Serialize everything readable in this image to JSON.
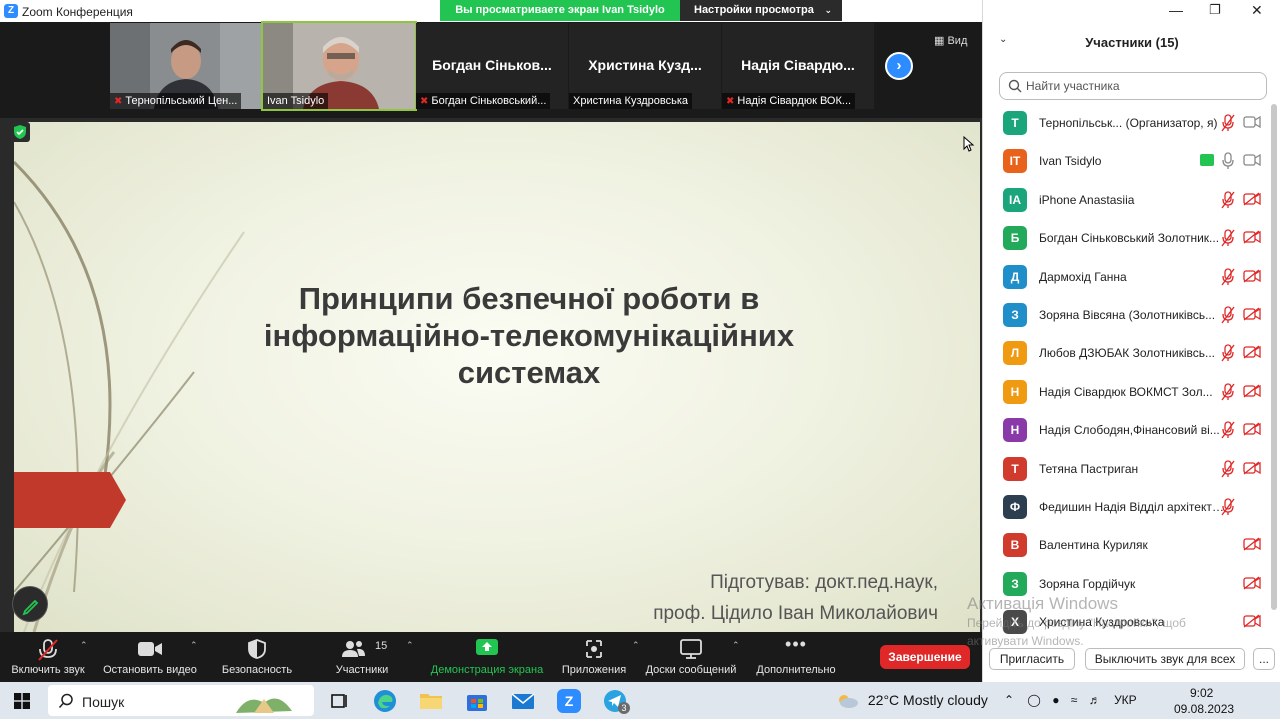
{
  "window": {
    "title": "Zoom Конференция",
    "share_banner": "Вы просматриваете экран Ivan Tsidylo",
    "view_settings": "Настройки просмотра",
    "view_button": "Вид"
  },
  "video_strip": [
    {
      "label": "Тернопільський Цен...",
      "muted": true,
      "camera": true
    },
    {
      "label": "Ivan Tsidylo",
      "muted": false,
      "camera": true
    },
    {
      "label": "Богдан Сіньковський...",
      "big_name": "Богдан Сіньков...",
      "muted": true,
      "camera": false
    },
    {
      "label": "Христина Куздровська",
      "big_name": "Христина Кузд...",
      "muted": false,
      "camera": false
    },
    {
      "label": "Надія Сівардюк ВОК...",
      "big_name": "Надія Сівардю...",
      "muted": true,
      "camera": false
    }
  ],
  "slide": {
    "title": "Принципи безпечної роботи в інформаційно-телекомунікаційних системах",
    "author_line_1": "Підготував: докт.пед.наук,",
    "author_line_2": "проф. Цідило Іван Миколайович"
  },
  "toolbar": {
    "audio": "Включить звук",
    "video": "Остановить видео",
    "security": "Безопасность",
    "participants": "Участники",
    "participants_count": "15",
    "share": "Демонстрация экрана",
    "apps": "Приложения",
    "whiteboards": "Доски сообщений",
    "more": "Дополнительно",
    "end": "Завершение"
  },
  "panel": {
    "title": "Участники (15)",
    "search_placeholder": "Найти участника",
    "invite": "Пригласить",
    "mute_all": "Выключить звук для всех",
    "more": "...",
    "participants": [
      {
        "initials": "Т",
        "name": "Тернопільськ...",
        "role": " (Организатор, я)",
        "color": "#1aa57a",
        "mic": "muted",
        "cam": "on"
      },
      {
        "initials": "IT",
        "name": "Ivan Tsidylo",
        "color": "#e8621c",
        "mic": "on",
        "cam": "on",
        "sharing": true
      },
      {
        "initials": "IA",
        "name": "iPhone Anastasiia",
        "color": "#1aa57a",
        "mic": "muted",
        "cam": "off"
      },
      {
        "initials": "Б",
        "name": "Богдан Сіньковський Золотник...",
        "color": "#23a95a",
        "mic": "muted",
        "cam": "off"
      },
      {
        "initials": "Д",
        "name": "Дармохід Ганна",
        "color": "#1f8fc9",
        "mic": "muted",
        "cam": "off"
      },
      {
        "initials": "З",
        "name": "Зоряна Вівсяна (Золотниківсь...",
        "color": "#1f8fc9",
        "mic": "muted",
        "cam": "off"
      },
      {
        "initials": "Л",
        "name": "Любов ДЗЮБАК Золотниківсь...",
        "color": "#ef9a10",
        "mic": "muted",
        "cam": "off"
      },
      {
        "initials": "Н",
        "name": "Надія Сівардюк ВОКМСТ Зол...",
        "color": "#ef9a10",
        "mic": "muted",
        "cam": "off"
      },
      {
        "initials": "Н",
        "name": "Надія Слободян,Фінансовий ві...",
        "color": "#8a3aa8",
        "mic": "muted",
        "cam": "off"
      },
      {
        "initials": "Т",
        "name": "Тетяна Пастриган",
        "color": "#d13b2d",
        "mic": "muted",
        "cam": "off"
      },
      {
        "initials": "Ф",
        "name": "Федишин Надія Відділ архітектури,...",
        "color": "#2c3e50",
        "mic": "muted",
        "cam": "none"
      },
      {
        "initials": "В",
        "name": "Валентина Куриляк",
        "color": "#d13b2d",
        "mic": "none",
        "cam": "off"
      },
      {
        "initials": "З",
        "name": "Зоряна Гордійчук",
        "color": "#23a95a",
        "mic": "none",
        "cam": "off"
      },
      {
        "initials": "Х",
        "name": "Христина Куздровська",
        "color": "#4a4a4a",
        "mic": "none",
        "cam": "off"
      }
    ]
  },
  "watermark": {
    "line1": "Активація Windows",
    "line2": "Перейдіть до розділу \"Настройки\", щоб",
    "line3": "активувати Windows."
  },
  "taskbar": {
    "search": "Пошук",
    "badge": "3",
    "weather": "22°C  Mostly cloudy",
    "lang": "УКР",
    "time": "9:02",
    "date": "09.08.2023"
  },
  "colors": {
    "accent_blue": "#2d8cff",
    "share_green": "#23c552",
    "end_red": "#e02828",
    "slide_arrow": "#c0392b"
  }
}
